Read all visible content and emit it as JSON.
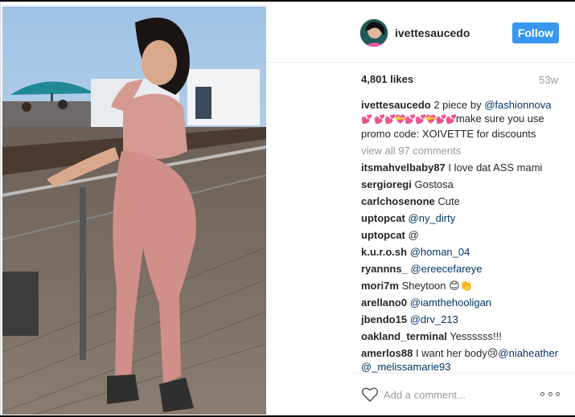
{
  "post": {
    "username": "ivettesaucedo",
    "follow_label": "Follow",
    "likes": "4,801 likes",
    "age": "53w"
  },
  "caption": {
    "user": "ivettesaucedo",
    "text_1": " 2 piece by ",
    "mention": "@fashionnova",
    "hearts_1": "💕",
    "hearts_2": "💕💕💝💕💕💝💕💕",
    "text_2": "make sure you use promo code: XOIVETTE for discounts"
  },
  "view_all": "view all 97 comments",
  "comments": [
    {
      "user": "itsmahvelbaby87",
      "text": " I love dat ASS mami",
      "mention": ""
    },
    {
      "user": "sergioregi",
      "text": " Gostosa",
      "mention": ""
    },
    {
      "user": "carlchosenone",
      "text": " Cute",
      "mention": ""
    },
    {
      "user": "uptopcat",
      "text": " ",
      "mention": "@ny_dirty"
    },
    {
      "user": "uptopcat",
      "text": " @",
      "mention": ""
    },
    {
      "user": "k.u.r.o.sh",
      "text": " ",
      "mention": "@homan_04"
    },
    {
      "user": "ryannns_",
      "text": " ",
      "mention": "@ereecefareye"
    },
    {
      "user": "mori7m",
      "text": " Sheytoon 😊👏",
      "mention": ""
    },
    {
      "user": "arellano0",
      "text": " ",
      "mention": "@iamthehooligan"
    },
    {
      "user": "jbendo15",
      "text": " ",
      "mention": "@drv_213"
    },
    {
      "user": "oakland_terminal",
      "text": " Yessssss!!!",
      "mention": ""
    }
  ],
  "last_comment": {
    "user": "amerlos88",
    "text": " I want her body😢",
    "mention_1": "@niaheather",
    "mention_2": "@_melissamarie93"
  },
  "footer": {
    "placeholder": "Add a comment...",
    "like_icon": "heart-outline-icon",
    "more_icon": "ellipsis-icon"
  },
  "colors": {
    "follow_button": "#3897f0",
    "mention": "#003569",
    "muted": "#999999"
  }
}
